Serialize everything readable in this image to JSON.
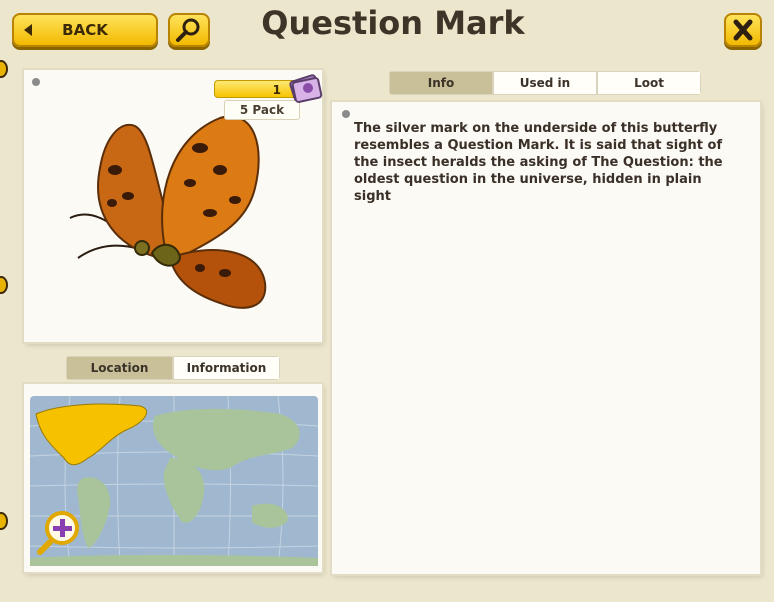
{
  "header": {
    "back_label": "BACK",
    "title": "Question Mark"
  },
  "item": {
    "quantity": "1",
    "pack_label": "5 Pack",
    "description": "The silver mark on the underside of this butterfly resembles a Question Mark. It is said that sight of the insect heralds the asking of The Question: the oldest question in the universe, hidden in plain sight"
  },
  "info_tabs": [
    {
      "label": "Info",
      "active": true
    },
    {
      "label": "Used in",
      "active": false
    },
    {
      "label": "Loot",
      "active": false
    }
  ],
  "location_tabs": [
    {
      "label": "Location",
      "active": true
    },
    {
      "label": "Information",
      "active": false
    }
  ],
  "icons": {
    "back": "left-arrow-icon",
    "search": "magnifier-icon",
    "close": "close-x-icon",
    "zoom": "zoom-in-icon",
    "pack": "card-pack-icon"
  },
  "colors": {
    "button_yellow": "#f2b900",
    "map_ocean": "#9fb8cf",
    "map_land": "#a9c49a",
    "map_highlight": "#f6c200",
    "tab_active": "#c9c09a"
  }
}
